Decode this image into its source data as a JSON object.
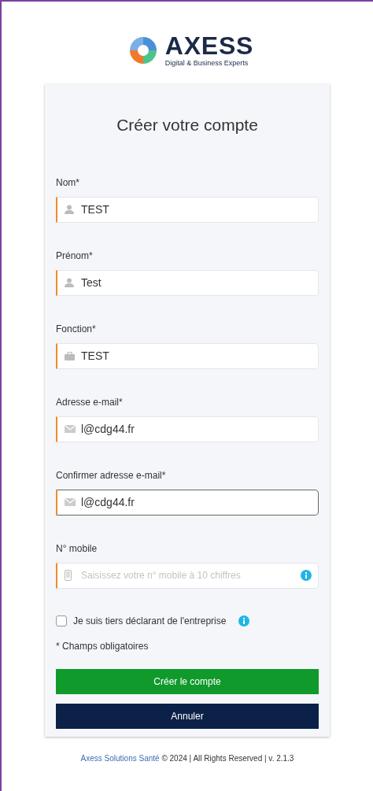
{
  "logo": {
    "name": "AXESS",
    "tagline": "Digital & Business Experts"
  },
  "form": {
    "title": "Créer votre compte",
    "fields": [
      {
        "label": "Nom*",
        "kind": "person",
        "value": "TEST",
        "focused": false
      },
      {
        "label": "Prénom*",
        "kind": "person",
        "value": "Test",
        "focused": false
      },
      {
        "label": "Fonction*",
        "kind": "briefcase",
        "value": "TEST",
        "focused": false
      },
      {
        "label": "Adresse e-mail*",
        "kind": "mail",
        "value": "l@cdg44.fr",
        "focused": false
      },
      {
        "label": "Confirmer adresse e-mail*",
        "kind": "mail",
        "value": "l@cdg44.fr",
        "focused": true
      },
      {
        "label": "N° mobile",
        "kind": "phone",
        "placeholder": "Saisissez votre n° mobile à 10 chiffres",
        "info": true,
        "focused": false
      }
    ],
    "checkbox": {
      "label": "Je suis tiers déclarant de l'entreprise",
      "checked": false
    },
    "note": "* Champs obligatoires",
    "buttons": [
      {
        "label": "Créer le compte",
        "kind": "primary"
      },
      {
        "label": "Annuler",
        "kind": "secondary"
      }
    ]
  },
  "footer": {
    "link": "Axess Solutions Santé",
    "text": "© 2024 | All Rights Reserved | v. 2.1.3"
  }
}
